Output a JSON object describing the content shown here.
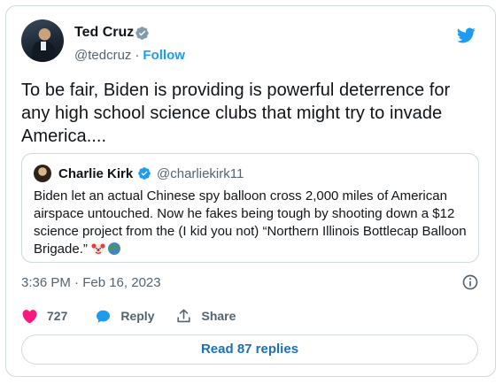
{
  "tweet": {
    "author": {
      "name": "Ted Cruz",
      "handle": "@tedcruz",
      "separator": "·",
      "follow_label": "Follow"
    },
    "text": "To be fair, Biden is providing is powerful deterrence for any high school science clubs that might try to invade America....",
    "quoted": {
      "name": "Charlie Kirk",
      "handle": "@charliekirk11",
      "text": "Biden let an actual Chinese spy balloon cross 2,000 miles of American airspace untouched. Now he fakes being tough by shooting down a $12 science project from the (I kid you not) “Northern Illinois Bottlecap Balloon Brigade.” ",
      "emojis": [
        "clown-face",
        "globe"
      ]
    },
    "timestamp": "3:36 PM · Feb 16, 2023",
    "actions": {
      "like_count": "727",
      "reply_label": "Reply",
      "share_label": "Share"
    },
    "read_replies_label": "Read 87 replies"
  },
  "colors": {
    "brand": "#1d9bf0",
    "like": "#f91880",
    "text": "#0f1419",
    "muted": "#536471",
    "border": "#cfd9de"
  },
  "icons": [
    "verified-icon",
    "twitter-bird-icon",
    "info-icon",
    "heart-icon",
    "reply-bubble-icon",
    "share-icon"
  ]
}
